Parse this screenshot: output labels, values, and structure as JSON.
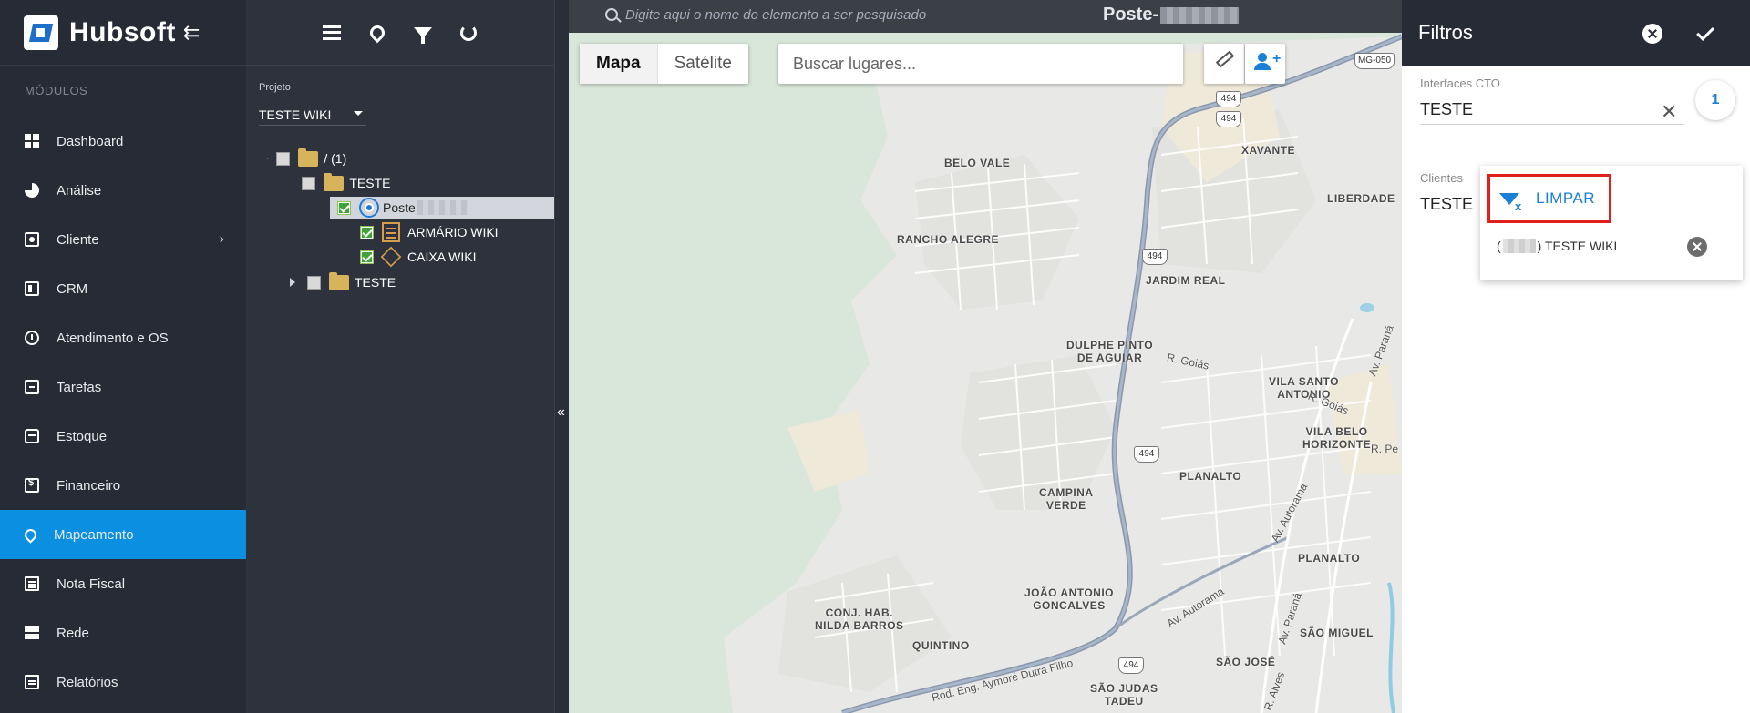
{
  "sidebar": {
    "brand": "Hubsoft",
    "collapse_icon": "menu-collapse-icon",
    "section_title": "MÓDULOS",
    "items": [
      {
        "label": "Dashboard",
        "icon": "dashboard-icon",
        "active": false
      },
      {
        "label": "Análise",
        "icon": "pie-chart-icon",
        "active": false
      },
      {
        "label": "Cliente",
        "icon": "client-card-icon",
        "active": false,
        "has_submenu": true
      },
      {
        "label": "CRM",
        "icon": "crm-board-icon",
        "active": false
      },
      {
        "label": "Atendimento e OS",
        "icon": "clock-icon",
        "active": false
      },
      {
        "label": "Tarefas",
        "icon": "tasks-icon",
        "active": false
      },
      {
        "label": "Estoque",
        "icon": "stock-icon",
        "active": false
      },
      {
        "label": "Financeiro",
        "icon": "money-icon",
        "active": false
      },
      {
        "label": "Mapeamento",
        "icon": "map-pin-icon",
        "active": true
      },
      {
        "label": "Nota Fiscal",
        "icon": "invoice-icon",
        "active": false
      },
      {
        "label": "Rede",
        "icon": "network-icon",
        "active": false
      },
      {
        "label": "Relatórios",
        "icon": "report-icon",
        "active": false
      }
    ],
    "active_color": "#0b8fe0"
  },
  "tree": {
    "toolbar_icons": [
      "hamburger-menu-icon",
      "map-marker-icon",
      "filter-icon",
      "refresh-icon"
    ],
    "project_label": "Projeto",
    "project_value": "TESTE WIKI",
    "nodes": [
      {
        "label": "/ (1)",
        "checked": false
      },
      {
        "label": "TESTE",
        "checked": false
      },
      {
        "label": "Poste",
        "checked": true,
        "selected": true
      },
      {
        "label": "ARMÁRIO WIKI",
        "checked": true
      },
      {
        "label": "CAIXA WIKI",
        "checked": true
      },
      {
        "label": "TESTE",
        "checked": false,
        "collapsed": true
      }
    ]
  },
  "map": {
    "header_search_placeholder": "Digite aqui o nome do elemento a ser pesquisado",
    "header_title": "Poste-",
    "map_types": [
      "Mapa",
      "Satélite"
    ],
    "active_map_type": "Mapa",
    "places_placeholder": "Buscar lugares...",
    "labels": {
      "xavante": "XAVANTE",
      "belo_vale": "BELO VALE",
      "liberdade": "LIBERDADE",
      "rancho_alegre": "RANCHO ALEGRE",
      "jardim_real": "JARDIM REAL",
      "dulphe": "DULPHE PINTO",
      "dulphe2": "DE AGUIAR",
      "vila_santo": "VILA SANTO",
      "vila_santo2": "ANTONIO",
      "vila_belo": "VILA BELO",
      "vila_belo2": "HORIZONTE",
      "planalto_top": "PLANALTO",
      "campina": "CAMPINA",
      "campina2": "VERDE",
      "planalto_bottom": "PLANALTO",
      "joao": "JOÃO ANTONIO",
      "joao2": "GONCALVES",
      "conj": "CONJ. HAB.",
      "conj2": "NILDA BARROS",
      "sao_miguel": "SÃO MIGUEL",
      "quintino": "QUINTINO",
      "sao_jose": "SÃO JOSÉ",
      "sao_judas": "SÃO JUDAS",
      "sao_judas2": "TADEU"
    },
    "roads": {
      "r_goias_1": "R. Goiás",
      "r_goias_2": "R. Goiás",
      "av_parana_1": "Av. Paraná",
      "av_parana_2": "Av. Paraná",
      "r_pe": "R. Pe",
      "av_autorama_1": "Av. Autorama",
      "av_autorama_2": "Av. Autorama",
      "rod": "Rod. Eng. Aymoré Dutra Filho",
      "r_alves": "R. Alves"
    },
    "shields": {
      "s1": "494",
      "s2": "494",
      "s3": "494",
      "s4": "494",
      "s5": "494",
      "s6": "494",
      "mg": "MG-050"
    }
  },
  "filters": {
    "title": "Filtros",
    "interfaces_label": "Interfaces CTO",
    "interfaces_value": "TESTE",
    "count": "1",
    "clientes_label": "Clientes",
    "clientes_value": "TESTE",
    "clear_label": "LIMPAR",
    "option_prefix": "(",
    "option_suffix": ") TESTE WIKI"
  }
}
